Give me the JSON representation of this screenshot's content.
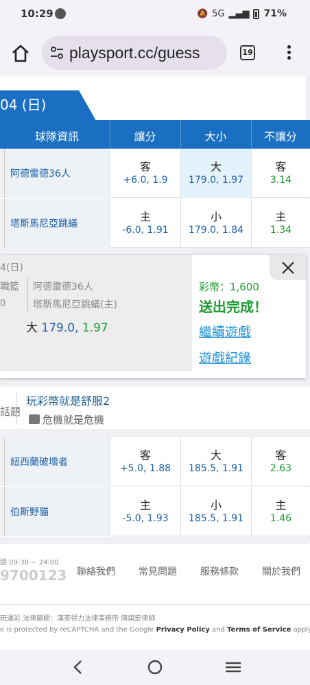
{
  "status_bar": {
    "time": "10:29",
    "network": "5G",
    "battery": "71%"
  },
  "browser": {
    "url": "playsport.cc/guess",
    "tab_count": "19"
  },
  "date_tab": "04 (日)",
  "table": {
    "headers": [
      "球隊資訊",
      "讓分",
      "大小",
      "不讓分"
    ],
    "games": [
      {
        "rows": [
          {
            "team": "阿德雷德36人",
            "spread_side": "客",
            "spread": "+6.0, 1.9",
            "total_side": "大",
            "total": "179.0, 1.97",
            "ml_side": "客",
            "ml": "3.14",
            "total_selected": true
          },
          {
            "team": "塔斯馬尼亞跳蟻",
            "spread_side": "主",
            "spread": "-6.0, 1.91",
            "total_side": "小",
            "total": "179.0, 1.84",
            "ml_side": "主",
            "ml": "1.34",
            "total_selected": false
          }
        ]
      },
      {
        "rows": [
          {
            "team": "紐西蘭破壞者",
            "spread_side": "客",
            "spread": "+5.0, 1.88",
            "total_side": "大",
            "total": "185.5, 1.91",
            "ml_side": "客",
            "ml": "2.63"
          },
          {
            "team": "伯斯野貓",
            "spread_side": "主",
            "spread": "-5.0, 1.93",
            "total_side": "小",
            "total": "185.5, 1.91",
            "ml_side": "主",
            "ml": "1.46"
          }
        ]
      }
    ]
  },
  "popup": {
    "ticket": {
      "date": "4(日)",
      "league": "職籃",
      "zero": "0",
      "away_team": "阿德雷德36人",
      "home_team": "塔斯馬尼亞跳蟻(主)",
      "pick_side": "大",
      "pick_value": "179.0,",
      "pick_odds": "1.97"
    },
    "coins": "彩幣：1,600",
    "sent": "送出完成！",
    "continue_link": "繼續遊戲",
    "record_link": "遊戲紀錄"
  },
  "forum": {
    "category": "話題",
    "title": "玩彩幣就是舒服2",
    "subtitle": "危機就是危機"
  },
  "footer": {
    "hours": "話 09:30 ~ 24:00",
    "phone": "9700123",
    "links": [
      "聯絡我們",
      "常見問題",
      "服務條款",
      "關於我們"
    ],
    "legal": "玩運彩 法律顧問：漢英得力法律事務所 陳鎮宏律師",
    "captcha_pre": "e is protected by reCAPTCHA and the Google",
    "privacy": "Privacy Policy",
    "and": "and",
    "terms": "Terms of Service",
    "apply": "apply."
  },
  "colors": {
    "brand_blue": "#1a6fc2",
    "odds_blue": "#1b60a8",
    "odds_green": "#1a9a2e",
    "link": "#1b8fd8"
  }
}
